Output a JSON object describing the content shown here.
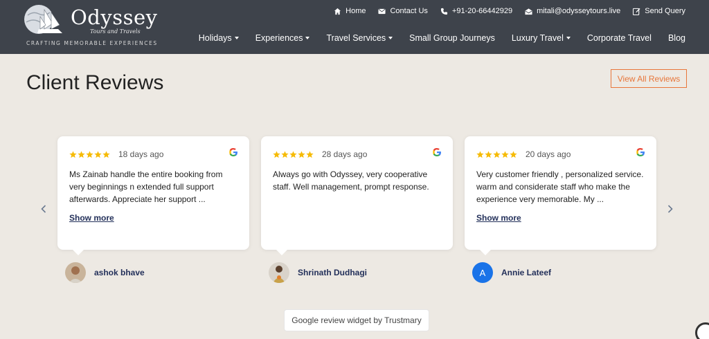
{
  "brand": {
    "name": "Odyssey",
    "sub": "Tours and Travels",
    "tagline": "CRAFTING MEMORABLE EXPERIENCES"
  },
  "topbar": {
    "home": "Home",
    "contact": "Contact Us",
    "phone": "+91-20-66442929",
    "email": "mitali@odysseytours.live",
    "query": "Send Query"
  },
  "nav": {
    "holidays": "Holidays",
    "experiences": "Experiences",
    "travel_services": "Travel Services",
    "small_group": "Small Group Journeys",
    "luxury": "Luxury Travel",
    "corporate": "Corporate Travel",
    "blog": "Blog"
  },
  "section": {
    "title": "Client Reviews",
    "view_all": "View All Reviews"
  },
  "reviews": [
    {
      "rating": 5,
      "date": "18 days ago",
      "text": "Ms Zainab handle the entire booking from very beginnings n extended full support afterwards. Appreciate her support ...",
      "show_more": "Show more",
      "reviewer": "ashok bhave"
    },
    {
      "rating": 5,
      "date": "28 days ago",
      "text": "Always go with Odyssey, very cooperative staff. Well management, prompt response.",
      "show_more": "",
      "reviewer": "Shrinath Dudhagi"
    },
    {
      "rating": 5,
      "date": "20 days ago",
      "text": "Very customer friendly , personalized service. warm and considerate staff who make the experience very memorable. My ...",
      "show_more": "Show more",
      "reviewer": "Annie Lateef",
      "initial": "A"
    }
  ],
  "widget_badge": "Google review widget by Trustmary",
  "colors": {
    "header_bg": "#3e434b",
    "page_bg": "#ede9e3",
    "accent_orange": "#e8763a",
    "star": "#f6bb06",
    "link_navy": "#23305a",
    "avatar_blue": "#1a73e8"
  },
  "icons": {
    "home": "home-icon",
    "contact": "envelope-icon",
    "phone": "phone-icon",
    "email": "email-open-icon",
    "query": "edit-icon",
    "google": "google-icon",
    "prev": "chevron-left-icon",
    "next": "chevron-right-icon"
  }
}
